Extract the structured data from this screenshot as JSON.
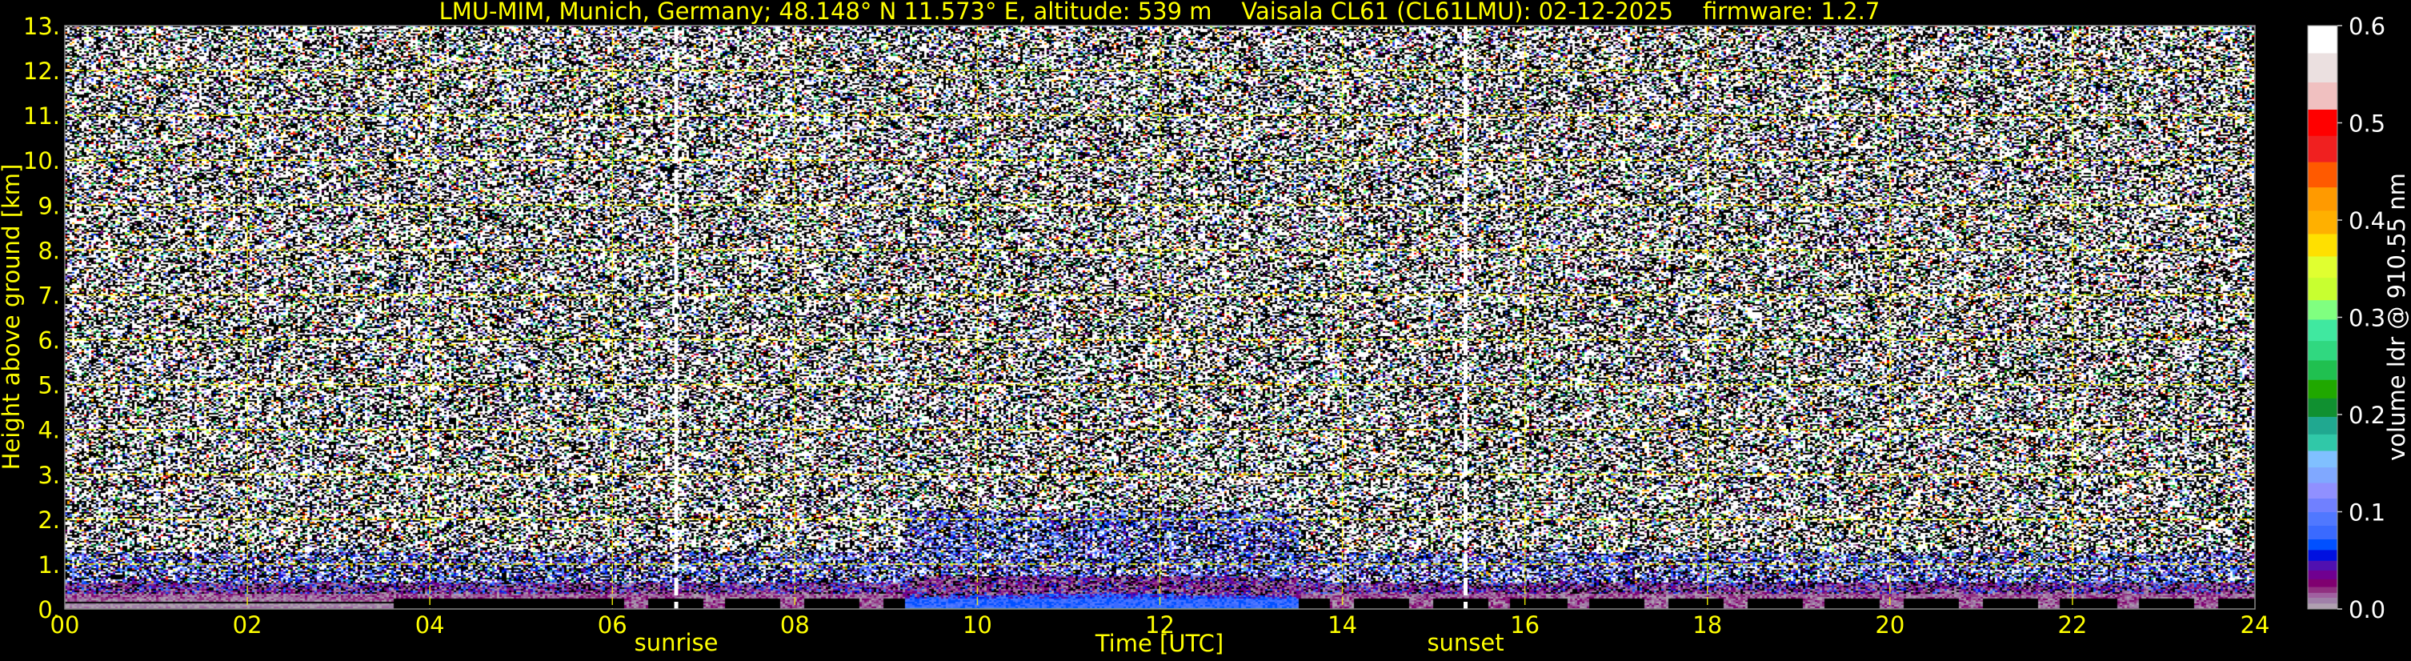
{
  "chart_data": {
    "type": "heatmap",
    "title": "LMU-MIM, Munich, Germany; 48.148° N 11.573° E, altitude: 539 m    Vaisala CL61 (CL61LMU): 02-12-2025    firmware: 1.2.7",
    "xlabel": "Time [UTC]",
    "ylabel": "Height above ground [km]",
    "xlim": [
      0,
      24
    ],
    "ylim": [
      0,
      13
    ],
    "x_ticks": [
      0,
      2,
      4,
      6,
      8,
      10,
      12,
      14,
      16,
      18,
      20,
      22,
      24
    ],
    "x_tick_labels": [
      "00",
      "02",
      "04",
      "06",
      "08",
      "10",
      "12",
      "14",
      "16",
      "18",
      "20",
      "22",
      "24"
    ],
    "y_ticks": [
      0,
      1,
      2,
      3,
      4,
      5,
      6,
      7,
      8,
      9,
      10,
      11,
      12,
      13
    ],
    "y_tick_labels": [
      "0.",
      "1.",
      "2.",
      "3.",
      "4.",
      "5.",
      "6.",
      "7.",
      "8.",
      "9.",
      "10.",
      "11.",
      "12.",
      "13."
    ],
    "grid": true,
    "annotations": [
      {
        "label": "sunrise",
        "x": 6.7
      },
      {
        "label": "sunset",
        "x": 15.35
      }
    ],
    "colorbar": {
      "label": "volume ldr @ 910.55 nm",
      "range": [
        0.0,
        0.6
      ],
      "ticks": [
        0.0,
        0.1,
        0.2,
        0.3,
        0.4,
        0.5,
        0.6
      ],
      "tick_labels": [
        "0.0",
        "0.1",
        "0.2",
        "0.3",
        "0.4",
        "0.5",
        "0.6"
      ],
      "bounds": [
        0,
        0.006,
        0.012,
        0.017,
        0.023,
        0.031,
        0.04,
        0.05,
        0.061,
        0.072,
        0.086,
        0.1,
        0.114,
        0.13,
        0.146,
        0.163,
        0.18,
        0.198,
        0.217,
        0.236,
        0.256,
        0.276,
        0.298,
        0.318,
        0.341,
        0.363,
        0.386,
        0.41,
        0.434,
        0.46,
        0.487,
        0.514,
        0.542,
        0.572,
        0.6
      ],
      "colors": [
        "#b0a0b0",
        "#a080a8",
        "#a060a0",
        "#903080",
        "#800070",
        "#700090",
        "#5010b0",
        "#0010e0",
        "#0050ff",
        "#3a6aff",
        "#5078ff",
        "#7080ff",
        "#9090ff",
        "#80a8ff",
        "#80c0ff",
        "#30c8a8",
        "#20a890",
        "#109030",
        "#20a800",
        "#20c050",
        "#30d880",
        "#40e8a0",
        "#80ff80",
        "#c8ff30",
        "#e0ff30",
        "#ffe000",
        "#ffb000",
        "#ff9a00",
        "#ff5a00",
        "#f02020",
        "#ff0000",
        "#f0c0c0",
        "#ebe0e0",
        "#ffffff"
      ]
    },
    "features": {
      "surface_aerosol_layer_top_km": 0.6,
      "daytime_low_ldr_layer": {
        "start_h": 9.2,
        "end_h": 13.5,
        "top_km": 0.35
      },
      "daytime_mixing_layer_top_km": 2.2
    }
  }
}
